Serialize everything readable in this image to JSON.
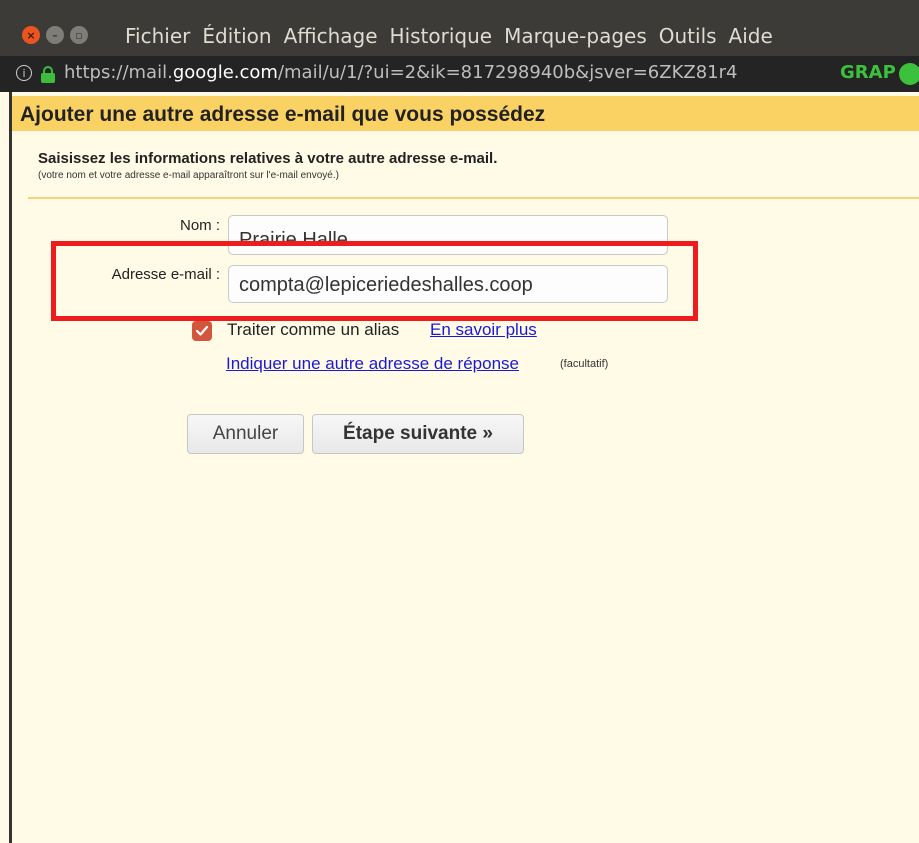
{
  "menu": {
    "items": [
      "Fichier",
      "Édition",
      "Affichage",
      "Historique",
      "Marque-pages",
      "Outils",
      "Aide"
    ]
  },
  "urlbar": {
    "url_prefix": "https://mail.",
    "url_domain": "google.com",
    "url_path": "/mail/u/1/?ui=2&ik=817298940b&jsver=6ZKZ81r4",
    "addon_label": "GRAP"
  },
  "dialog": {
    "title": "Ajouter une autre adresse e-mail que vous possédez",
    "instructions": "Saisissez les informations relatives à votre autre adresse e-mail.",
    "sub_instructions": "(votre nom et votre adresse e-mail apparaîtront sur l'e-mail envoyé.)",
    "name_label": "Nom :",
    "name_value": "Prairie Halle",
    "email_label": "Adresse e-mail :",
    "email_value": "compta@lepiceriedeshalles.coop",
    "alias_label": "Traiter comme un alias",
    "alias_checked": true,
    "learn_more": "En savoir plus",
    "reply_link": "Indiquer une autre adresse de réponse",
    "optional": "(facultatif)",
    "cancel_button": "Annuler",
    "next_button": "Étape suivante »"
  },
  "colors": {
    "title_bar": "#fad163",
    "highlight": "#ee1c1c",
    "checkbox": "#d2563b",
    "link": "#1a1ad6"
  }
}
